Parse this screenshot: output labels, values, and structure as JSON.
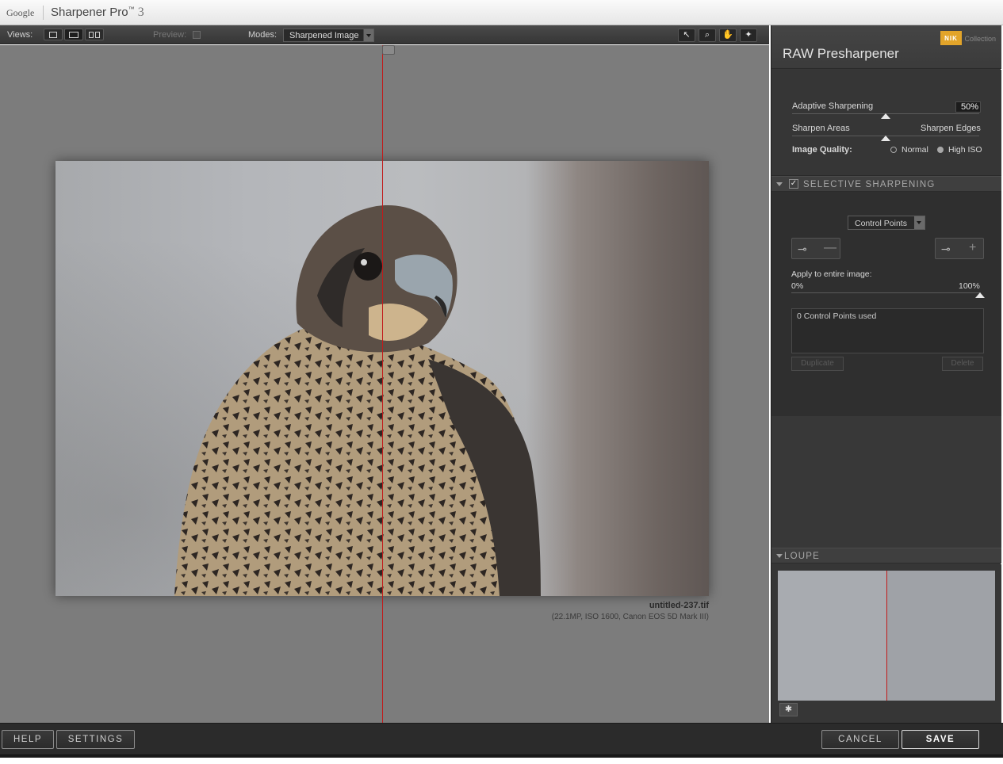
{
  "titlebar": {
    "vendor": "Google",
    "app_name": "Sharpener Pro",
    "trademark": "™",
    "version": "3"
  },
  "toolbar": {
    "views_label": "Views:",
    "preview_label": "Preview:",
    "modes_label": "Modes:",
    "mode_value": "Sharpened Image",
    "tools": [
      "arrow-pointer-icon",
      "zoom-icon",
      "hand-pan-icon",
      "control-point-icon"
    ]
  },
  "image": {
    "file_name": "untitled-237.tif",
    "file_meta": "(22.1MP, ISO 1600, Canon EOS 5D Mark III)"
  },
  "panel": {
    "brand_logo": "NIK",
    "brand_suffix": "Collection",
    "title": "RAW Presharpener",
    "adaptive_label": "Adaptive Sharpening",
    "adaptive_value": "50%",
    "areas_left": "Sharpen Areas",
    "areas_right": "Sharpen Edges",
    "quality_label": "Image Quality:",
    "quality_options": [
      "Normal",
      "High ISO"
    ],
    "quality_selected": "High ISO",
    "selective_title": "SELECTIVE SHARPENING",
    "control_select": "Control Points",
    "apply_label": "Apply to entire image:",
    "apply_min": "0%",
    "apply_max": "100%",
    "points_used": "0 Control Points used",
    "duplicate_label": "Duplicate",
    "delete_label": "Delete",
    "loupe_title": "LOUPE"
  },
  "bottom": {
    "help": "HELP",
    "settings": "SETTINGS",
    "cancel": "CANCEL",
    "save": "SAVE"
  },
  "colors": {
    "split_line": "#c21a1a",
    "accent_logo": "#e2a42a",
    "panel_bg": "#373737"
  }
}
